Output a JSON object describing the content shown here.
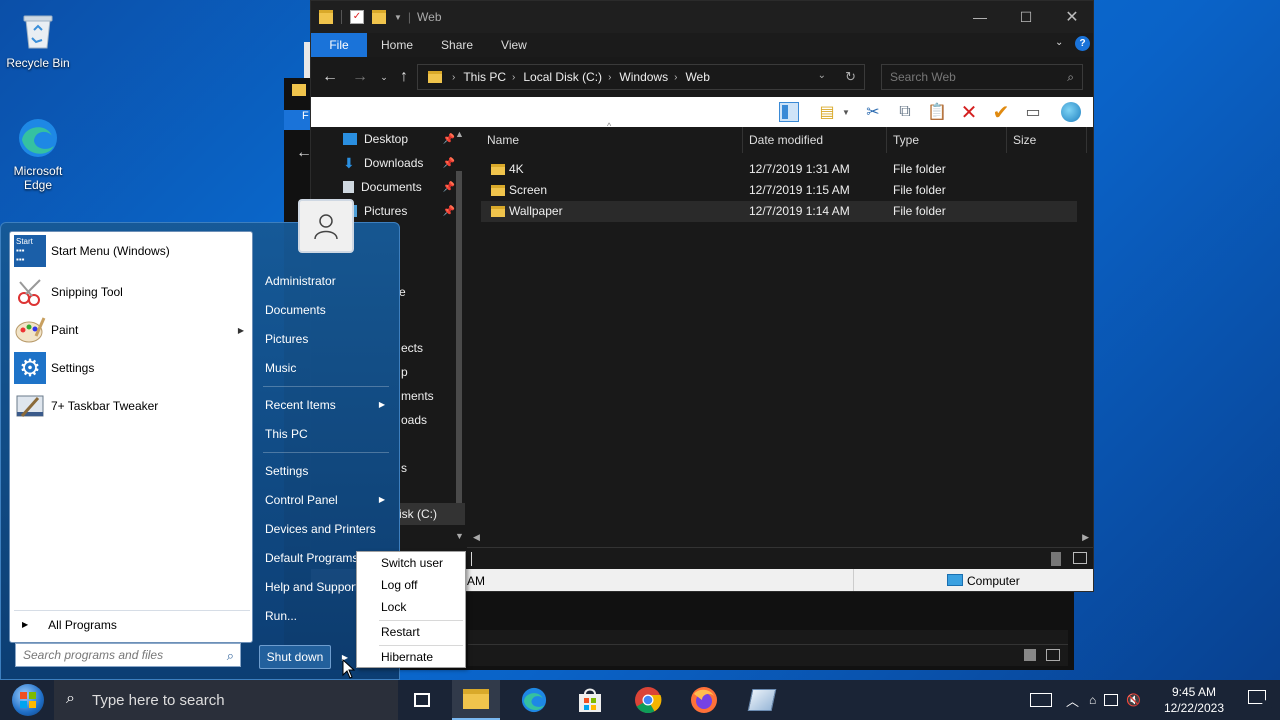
{
  "desktop": {
    "icons": [
      {
        "label": "Recycle Bin",
        "icon": "recycle-bin-icon"
      },
      {
        "label": "Microsoft Edge",
        "icon": "edge-icon"
      }
    ]
  },
  "explorer": {
    "title": "Web",
    "tabs": [
      "File",
      "Home",
      "Share",
      "View"
    ],
    "breadcrumb": [
      "This PC",
      "Local Disk (C:)",
      "Windows",
      "Web"
    ],
    "search_placeholder": "Search Web",
    "nav": [
      {
        "label": "Desktop",
        "icon": "desktop-icon"
      },
      {
        "label": "Downloads",
        "icon": "downloads-icon"
      },
      {
        "label": "Documents",
        "icon": "documents-icon"
      },
      {
        "label": "Pictures",
        "icon": "pictures-icon"
      }
    ],
    "nav_partial": [
      "e",
      "ects",
      "p",
      "ments",
      "oads",
      "s",
      "isk (C:)"
    ],
    "columns": [
      "Name",
      "Date modified",
      "Type",
      "Size"
    ],
    "files": [
      {
        "name": "4K",
        "date": "12/7/2019 1:31 AM",
        "type": "File folder"
      },
      {
        "name": "Screen",
        "date": "12/7/2019 1:15 AM",
        "type": "File folder"
      },
      {
        "name": "Wallpaper",
        "date": "12/7/2019 1:14 AM",
        "type": "File folder"
      }
    ],
    "status_left": "AM",
    "status_right": "Computer"
  },
  "startmenu": {
    "programs": [
      {
        "label": "Start Menu (Windows)",
        "icon": "start-menu-icon"
      },
      {
        "label": "Snipping Tool",
        "icon": "snipping-tool-icon"
      },
      {
        "label": "Paint",
        "icon": "paint-icon"
      },
      {
        "label": "Settings",
        "icon": "settings-gear-icon"
      },
      {
        "label": "7+ Taskbar Tweaker",
        "icon": "taskbar-tweaker-icon"
      }
    ],
    "all_programs": "All Programs",
    "search_placeholder": "Search programs and files",
    "right_items": [
      {
        "label": "Administrator",
        "arrow": false
      },
      {
        "label": "Documents",
        "arrow": false
      },
      {
        "label": "Pictures",
        "arrow": false
      },
      {
        "label": "Music",
        "arrow": false
      },
      {
        "label": "Recent Items",
        "arrow": true
      },
      {
        "label": "This PC",
        "arrow": false
      },
      {
        "label": "Settings",
        "arrow": false
      },
      {
        "label": "Control Panel",
        "arrow": true
      },
      {
        "label": "Devices and Printers",
        "arrow": false
      },
      {
        "label": "Default Programs",
        "arrow": false
      },
      {
        "label": "Help and Support",
        "arrow": false
      },
      {
        "label": "Run...",
        "arrow": false
      }
    ],
    "shutdown_label": "Shut down",
    "submenu": [
      "Switch user",
      "Log off",
      "Lock",
      "Restart",
      "Hibernate"
    ]
  },
  "taskbar": {
    "search_placeholder": "Type here to search",
    "time": "9:45 AM",
    "date": "12/22/2023"
  }
}
